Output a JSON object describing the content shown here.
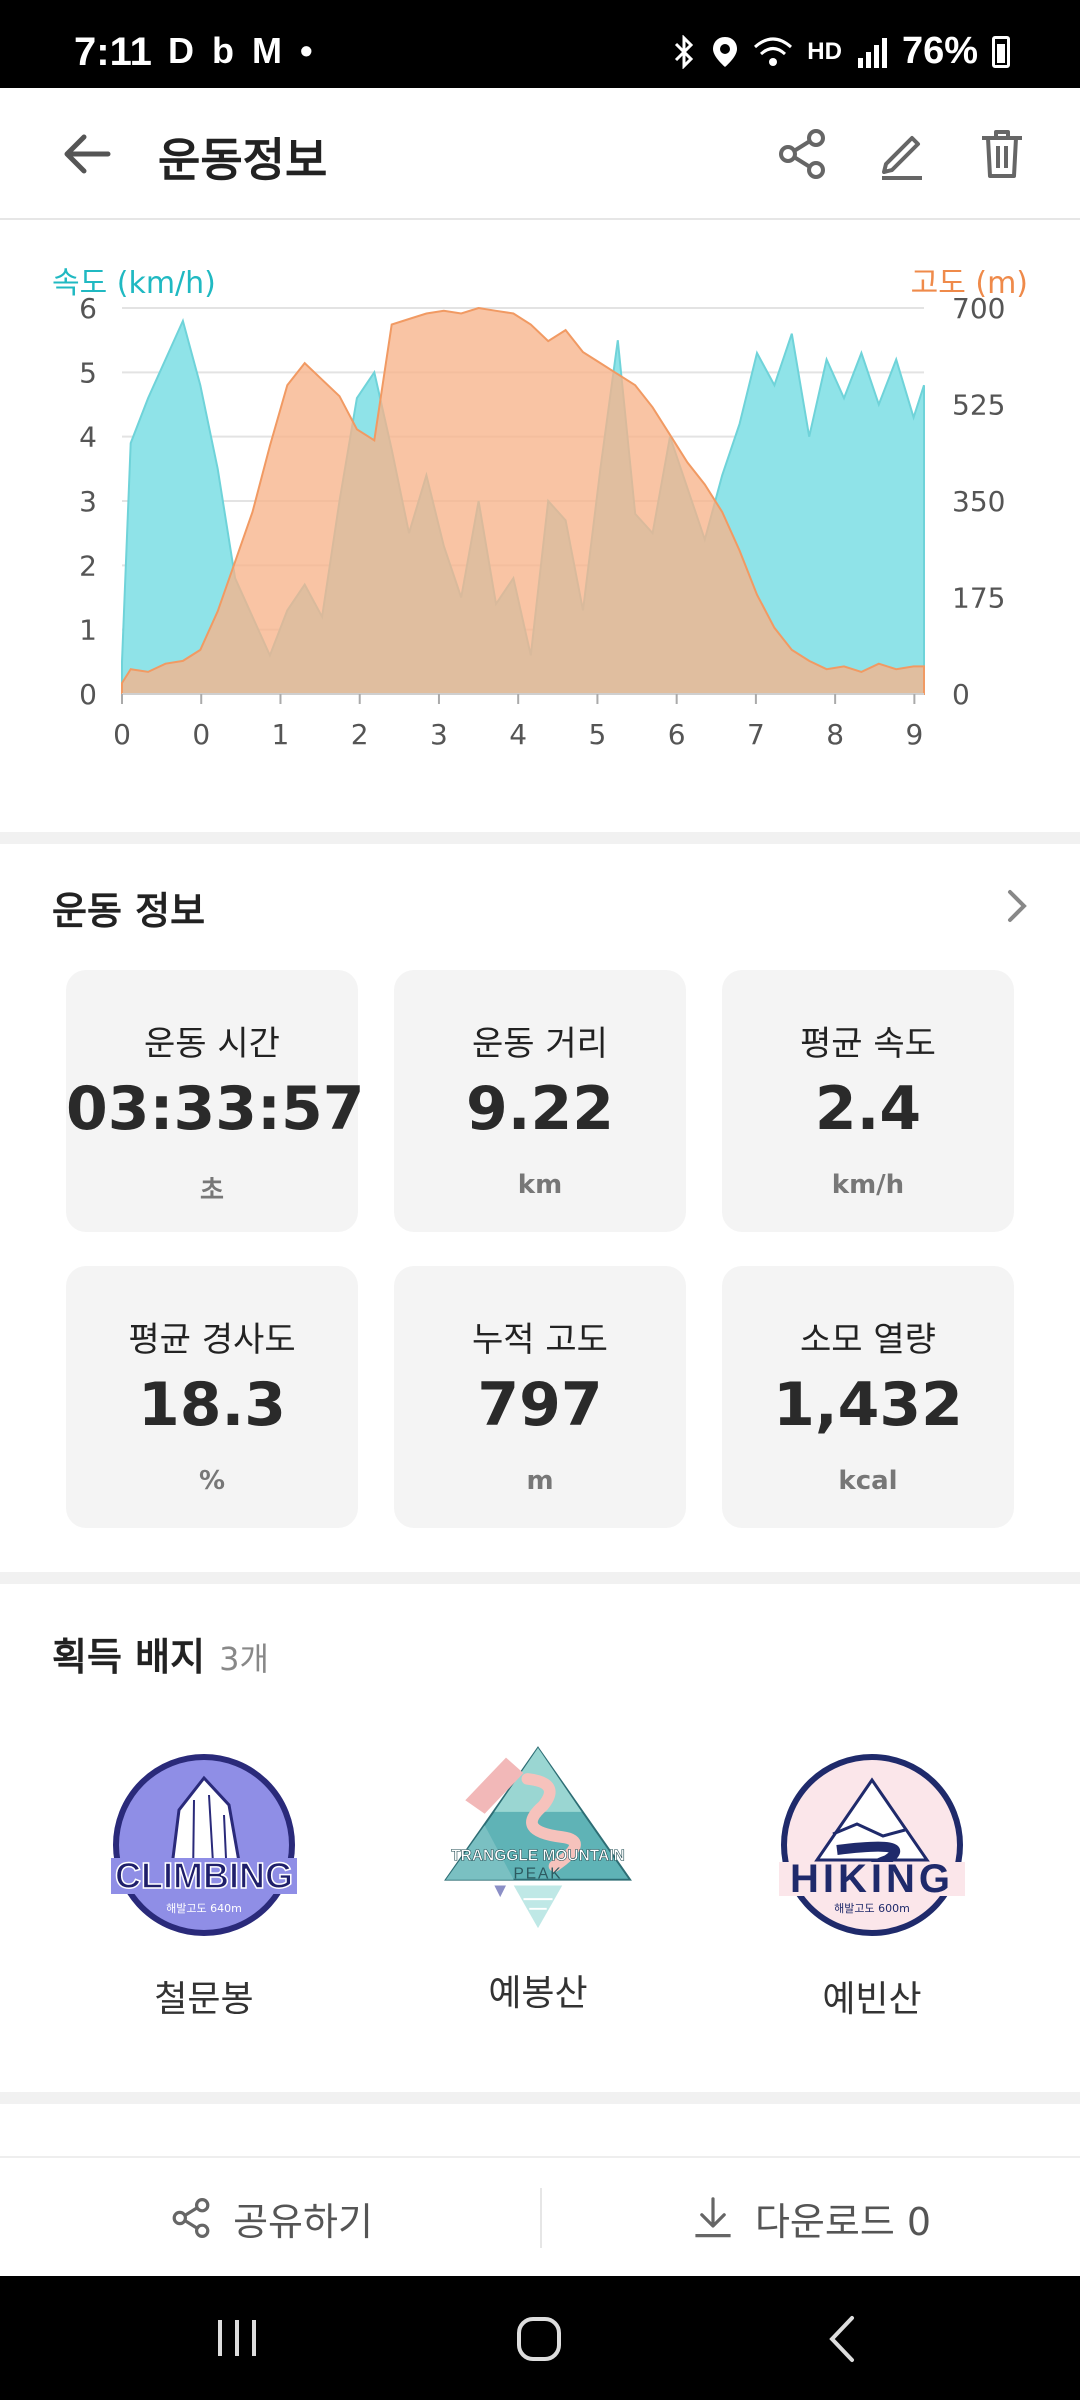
{
  "status": {
    "time": "7:11",
    "left_icons": "D b M •",
    "right_text": "HD",
    "battery": "76%"
  },
  "appbar": {
    "title": "운동정보",
    "actions": [
      "share-icon",
      "edit-icon",
      "trash-icon"
    ]
  },
  "chart_data": {
    "type": "area",
    "left_axis_label": "속도 (km/h)",
    "right_axis_label": "고도 (m)",
    "x_ticks": [
      "0",
      "0",
      "1",
      "2",
      "3",
      "4",
      "5",
      "6",
      "7",
      "8",
      "9"
    ],
    "y_left_ticks": [
      "6",
      "5",
      "4",
      "3",
      "2",
      "1",
      "0"
    ],
    "y_right_ticks": [
      "700",
      "525",
      "350",
      "175",
      "0"
    ],
    "ylim_left": [
      0,
      6
    ],
    "ylim_right": [
      0,
      700
    ],
    "x": [
      0,
      0.1,
      0.3,
      0.5,
      0.7,
      0.9,
      1.1,
      1.3,
      1.5,
      1.7,
      1.9,
      2.1,
      2.3,
      2.5,
      2.7,
      2.9,
      3.1,
      3.3,
      3.5,
      3.7,
      3.9,
      4.1,
      4.3,
      4.5,
      4.7,
      4.9,
      5.1,
      5.3,
      5.5,
      5.7,
      5.9,
      6.1,
      6.3,
      6.5,
      6.7,
      6.9,
      7.1,
      7.3,
      7.5,
      7.7,
      7.9,
      8.1,
      8.3,
      8.5,
      8.7,
      8.9,
      9.1,
      9.22
    ],
    "series": [
      {
        "name": "속도 (km/h)",
        "axis": "left",
        "color": "#8fe3e8",
        "values": [
          0.5,
          3.9,
          4.6,
          5.2,
          5.8,
          4.8,
          3.5,
          1.8,
          1.2,
          0.6,
          1.3,
          1.7,
          1.2,
          3.0,
          4.6,
          5.0,
          3.8,
          2.5,
          3.4,
          2.3,
          1.5,
          3.0,
          1.4,
          1.8,
          0.6,
          3.0,
          2.7,
          1.3,
          3.5,
          5.5,
          2.8,
          2.5,
          4.0,
          3.2,
          2.4,
          3.4,
          4.2,
          5.3,
          4.8,
          5.6,
          4.0,
          5.2,
          4.6,
          5.3,
          4.5,
          5.2,
          4.3,
          4.8
        ]
      },
      {
        "name": "고도 (m)",
        "axis": "right",
        "color": "#f7b38a",
        "values": [
          20,
          45,
          40,
          55,
          60,
          80,
          150,
          240,
          330,
          450,
          560,
          600,
          570,
          540,
          480,
          460,
          670,
          680,
          690,
          695,
          690,
          700,
          695,
          690,
          670,
          640,
          660,
          620,
          600,
          580,
          560,
          520,
          470,
          420,
          380,
          330,
          260,
          180,
          120,
          80,
          60,
          45,
          50,
          40,
          55,
          45,
          50,
          50
        ]
      }
    ]
  },
  "workout": {
    "title": "운동 정보",
    "cards": [
      {
        "label": "운동 시간",
        "value": "03:33:57",
        "unit": "초"
      },
      {
        "label": "운동 거리",
        "value": "9.22",
        "unit": "km"
      },
      {
        "label": "평균 속도",
        "value": "2.4",
        "unit": "km/h"
      },
      {
        "label": "평균 경사도",
        "value": "18.3",
        "unit": "%"
      },
      {
        "label": "누적 고도",
        "value": "797",
        "unit": "m"
      },
      {
        "label": "소모 열량",
        "value": "1,432",
        "unit": "kcal"
      }
    ]
  },
  "badges": {
    "title": "획득 배지",
    "count": "3개",
    "items": [
      {
        "name": "철문봉",
        "emblem_text": "CLIMBING",
        "emblem_sub": "해발고도 640m"
      },
      {
        "name": "예봉산",
        "emblem_text": "TRANGGLE MOUNTAIN",
        "emblem_sub": "PEAK"
      },
      {
        "name": "예빈산",
        "emblem_text": "HIKING",
        "emblem_sub": "해발고도 600m"
      }
    ]
  },
  "bottom": {
    "share_label": "공유하기",
    "download_label": "다운로드 0"
  }
}
